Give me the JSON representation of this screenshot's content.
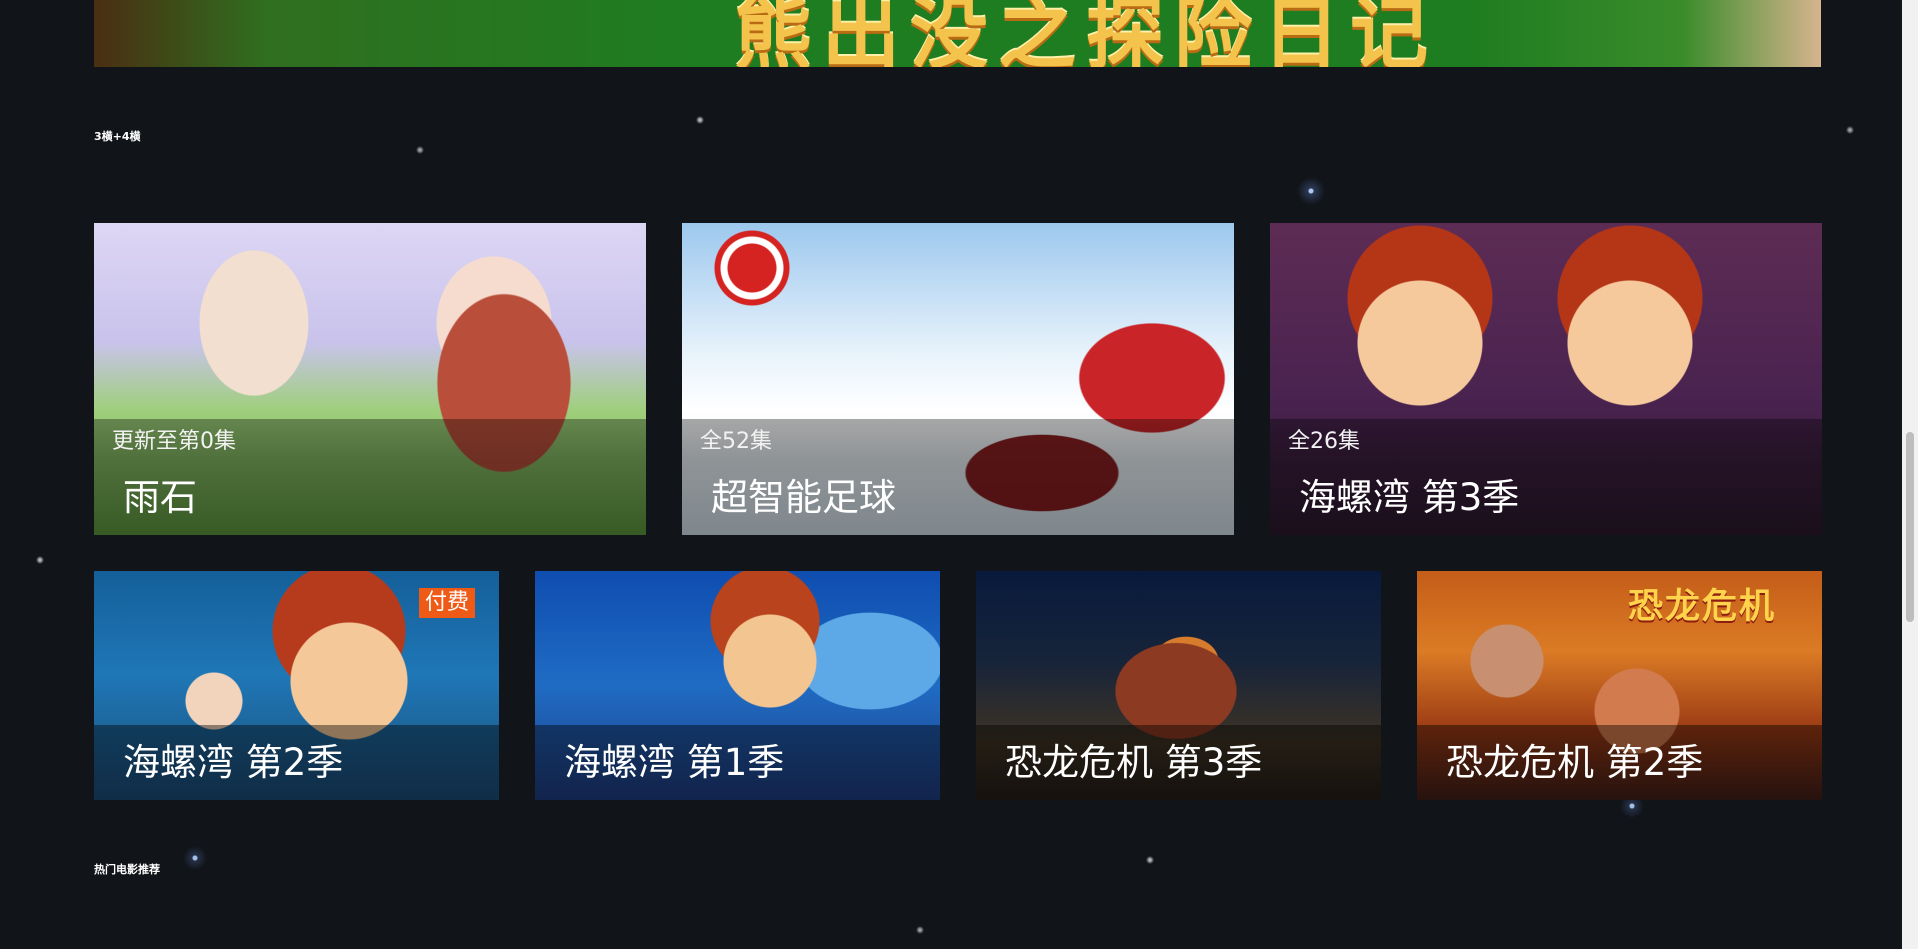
{
  "banner": {
    "title_text": "熊出没之探险日记"
  },
  "sections": {
    "primary_title": "3横+4横",
    "secondary_title": "热门电影推荐"
  },
  "top_cards": [
    {
      "episode": "更新至第0集",
      "title": "雨石"
    },
    {
      "episode": "全52集",
      "title": "超智能足球"
    },
    {
      "episode": "全26集",
      "title": "海螺湾 第3季"
    }
  ],
  "bottom_cards": [
    {
      "title": "海螺湾 第2季",
      "badge": "付费"
    },
    {
      "title": "海螺湾 第1季"
    },
    {
      "title": "恐龙危机 第3季"
    },
    {
      "title": "恐龙危机 第2季",
      "poster_label": "恐龙危机"
    }
  ],
  "colors": {
    "badge": "#ef5a17",
    "background": "#111419"
  }
}
